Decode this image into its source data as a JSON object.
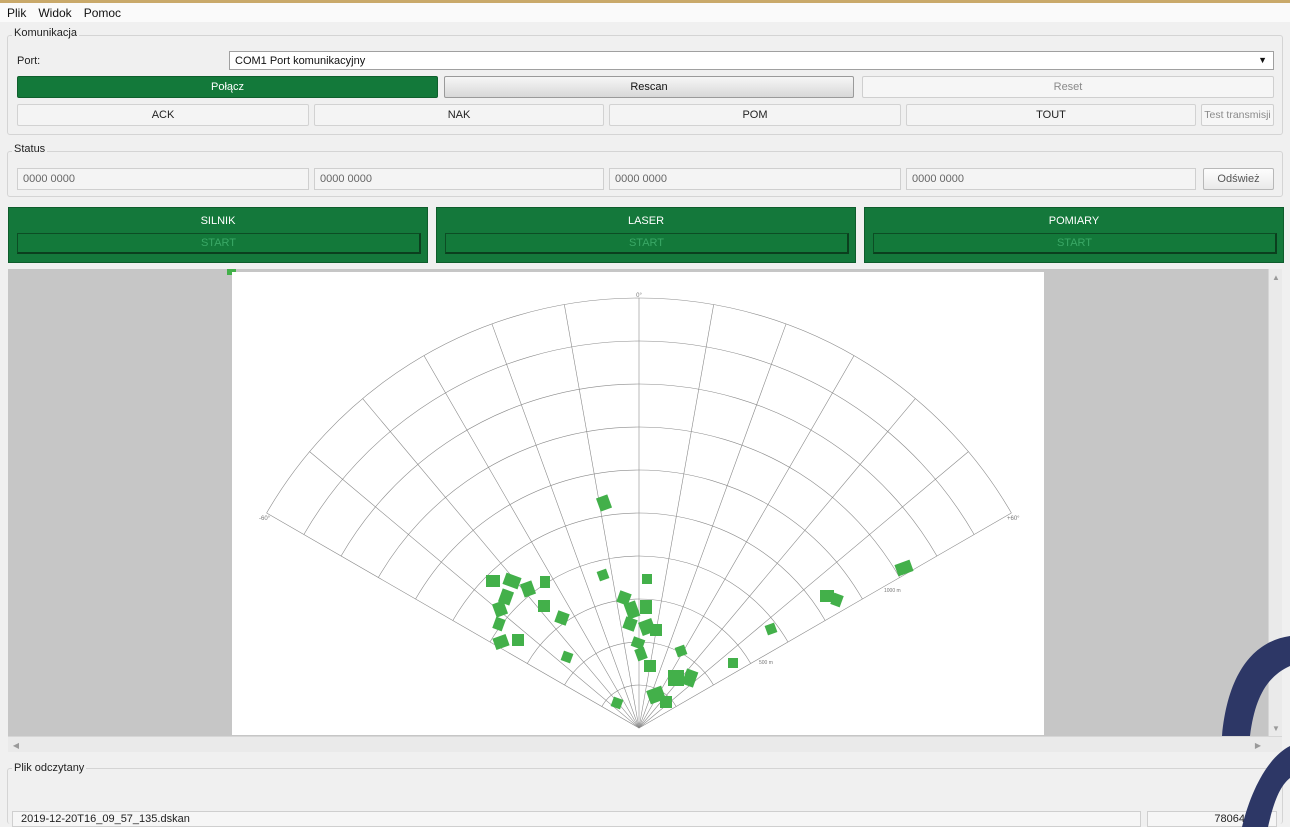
{
  "menu": {
    "items": [
      "Plik",
      "Widok",
      "Pomoc"
    ]
  },
  "komunikacja": {
    "title": "Komunikacja",
    "port_label": "Port:",
    "port_value": "COM1 Port komunikacyjny",
    "connect_label": "Połącz",
    "rescan_label": "Rescan",
    "reset_label": "Reset",
    "ack_label": "ACK",
    "nak_label": "NAK",
    "pom_label": "POM",
    "tout_label": "TOUT",
    "test_label": "Test transmisji"
  },
  "status": {
    "title": "Status",
    "fields": [
      "0000 0000",
      "0000 0000",
      "0000 0000",
      "0000 0000"
    ],
    "refresh_label": "Odśwież"
  },
  "panels": [
    {
      "title": "SILNIK",
      "button": "START"
    },
    {
      "title": "LASER",
      "button": "START"
    },
    {
      "title": "POMIARY",
      "button": "START"
    }
  ],
  "radar": {
    "label_top": "0°",
    "label_left": "-60°",
    "label_right": "+60°",
    "range_labels": [
      "500 m",
      "1000 m"
    ],
    "max_range_m": 1000,
    "angle_span_deg": 120,
    "colors": {
      "grid": "#8a8a8a",
      "target": "#43b04a"
    }
  },
  "footer": {
    "title": "Plik odczytany",
    "filename": "2019-12-20T16_09_57_135.dskan",
    "filesize": "78064.6 kB"
  }
}
